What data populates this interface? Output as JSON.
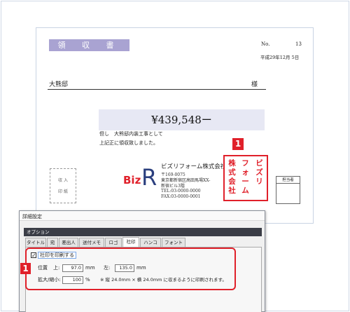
{
  "receipt": {
    "title": "領 収 書",
    "no_label": "No.",
    "no_value": "13",
    "date": "平成29年12月 5日",
    "recipient": "大熊邸",
    "honorific": "様",
    "amount": "¥439,548ー",
    "note_line1": "但し　大熊邸内装工事として",
    "note_line2": "上記正に領収致しました。",
    "stamp_label_1": "収 入",
    "stamp_label_2": "印 紙",
    "logo_text": "Biz",
    "logo_mark": "R",
    "company_name": "ビズリフォーム株式会社",
    "company_lines": [
      "〒169-0075",
      "東京都新宿区高田馬場XX-",
      "新宿ビル3階",
      "TEL:03-0000-0000",
      "FAX:03-0000-0001"
    ],
    "seal_columns": [
      "株式会社",
      "フォーム",
      "ビズリ"
    ],
    "manager_label": "担当者",
    "badge": "1",
    "colors": {
      "title_bg": "#a9a3d2",
      "amount_bg": "#e7e8f4",
      "seal": "#e0202a"
    }
  },
  "dialog": {
    "title": "詳細設定",
    "section": "オプション",
    "tabs": [
      "タイトル",
      "宛",
      "差出人",
      "送付メモ",
      "ロゴ",
      "社印",
      "ハンコ",
      "フォント"
    ],
    "active_tab": "社印",
    "checkbox_label": "社印を印刷する",
    "checkbox_checked": true,
    "position_label": "位置",
    "top_label": "上:",
    "top_value": "97.0",
    "unit_mm": "mm",
    "left_label": "左:",
    "left_value": "135.0",
    "scale_label": "拡大/縮小:",
    "scale_value": "100",
    "unit_percent": "%",
    "scale_note": "※ 縦 24.0mm × 横 24.0mm に収まるように印刷されます。",
    "badge": "1"
  }
}
